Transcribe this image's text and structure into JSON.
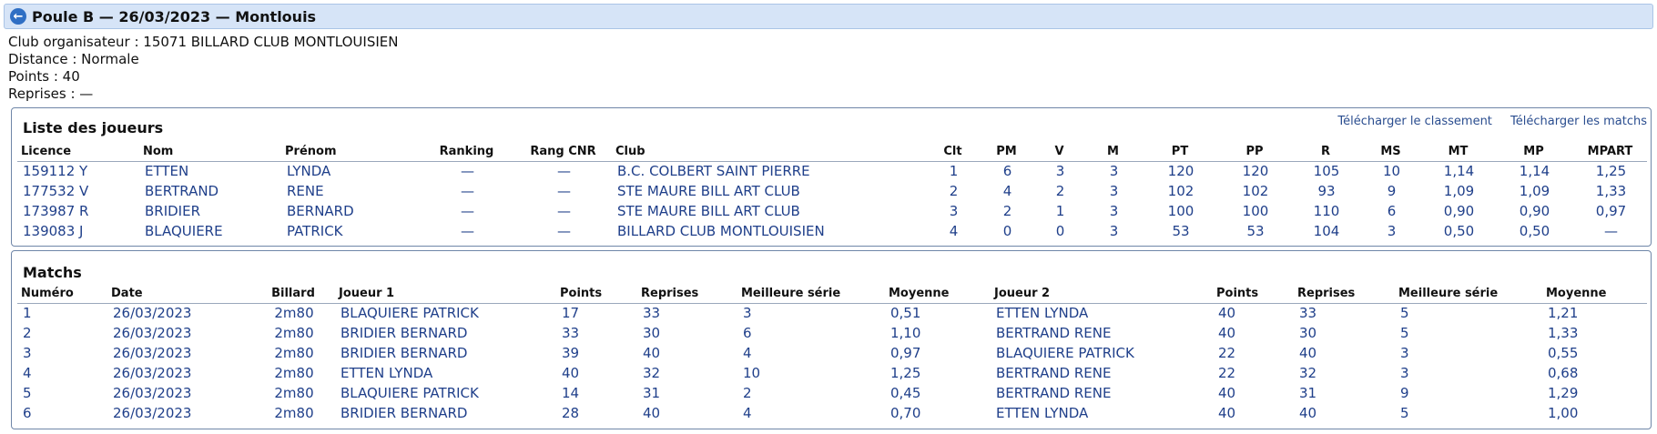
{
  "header": {
    "title": "Poule B — 26/03/2023 — Montlouis"
  },
  "info": {
    "club": "Club organisateur : 15071 BILLARD CLUB MONTLOUISIEN",
    "distance": "Distance : Normale",
    "points": "Points : 40",
    "reprises": "Reprises : —"
  },
  "players": {
    "title": "Liste des joueurs",
    "links": {
      "classement": "Télécharger le classement",
      "matchs": "Télécharger les matchs"
    },
    "columns": [
      "Licence",
      "Nom",
      "Prénom",
      "Ranking",
      "Rang CNR",
      "Club",
      "Clt",
      "PM",
      "V",
      "M",
      "PT",
      "PP",
      "R",
      "MS",
      "MT",
      "MP",
      "MPART"
    ],
    "rows": [
      [
        "159112 Y",
        "ETTEN",
        "LYNDA",
        "—",
        "—",
        "B.C. COLBERT SAINT PIERRE",
        "1",
        "6",
        "3",
        "3",
        "120",
        "120",
        "105",
        "10",
        "1,14",
        "1,14",
        "1,25"
      ],
      [
        "177532 V",
        "BERTRAND",
        "RENE",
        "—",
        "—",
        "STE MAURE BILL ART CLUB",
        "2",
        "4",
        "2",
        "3",
        "102",
        "102",
        "93",
        "9",
        "1,09",
        "1,09",
        "1,33"
      ],
      [
        "173987 R",
        "BRIDIER",
        "BERNARD",
        "—",
        "—",
        "STE MAURE BILL ART CLUB",
        "3",
        "2",
        "1",
        "3",
        "100",
        "100",
        "110",
        "6",
        "0,90",
        "0,90",
        "0,97"
      ],
      [
        "139083 J",
        "BLAQUIERE",
        "PATRICK",
        "—",
        "—",
        "BILLARD CLUB MONTLOUISIEN",
        "4",
        "0",
        "0",
        "3",
        "53",
        "53",
        "104",
        "3",
        "0,50",
        "0,50",
        "—"
      ]
    ]
  },
  "matchs": {
    "title": "Matchs",
    "columns": [
      "Numéro",
      "Date",
      "Billard",
      "Joueur 1",
      "Points",
      "Reprises",
      "Meilleure série",
      "Moyenne",
      "Joueur 2",
      "Points",
      "Reprises",
      "Meilleure série",
      "Moyenne"
    ],
    "rows": [
      [
        "1",
        "26/03/2023",
        "2m80",
        "BLAQUIERE PATRICK",
        "17",
        "33",
        "3",
        "0,51",
        "ETTEN LYNDA",
        "40",
        "33",
        "5",
        "1,21"
      ],
      [
        "2",
        "26/03/2023",
        "2m80",
        "BRIDIER BERNARD",
        "33",
        "30",
        "6",
        "1,10",
        "BERTRAND RENE",
        "40",
        "30",
        "5",
        "1,33"
      ],
      [
        "3",
        "26/03/2023",
        "2m80",
        "BRIDIER BERNARD",
        "39",
        "40",
        "4",
        "0,97",
        "BLAQUIERE PATRICK",
        "22",
        "40",
        "3",
        "0,55"
      ],
      [
        "4",
        "26/03/2023",
        "2m80",
        "ETTEN LYNDA",
        "40",
        "32",
        "10",
        "1,25",
        "BERTRAND RENE",
        "22",
        "32",
        "3",
        "0,68"
      ],
      [
        "5",
        "26/03/2023",
        "2m80",
        "BLAQUIERE PATRICK",
        "14",
        "31",
        "2",
        "0,45",
        "BERTRAND RENE",
        "40",
        "31",
        "9",
        "1,29"
      ],
      [
        "6",
        "26/03/2023",
        "2m80",
        "BRIDIER BERNARD",
        "28",
        "40",
        "4",
        "0,70",
        "ETTEN LYNDA",
        "40",
        "40",
        "5",
        "1,00"
      ]
    ]
  },
  "colors": {
    "link": "#1f3f8a",
    "titlebar": "#d6e4f7",
    "border": "#6f86a8"
  }
}
